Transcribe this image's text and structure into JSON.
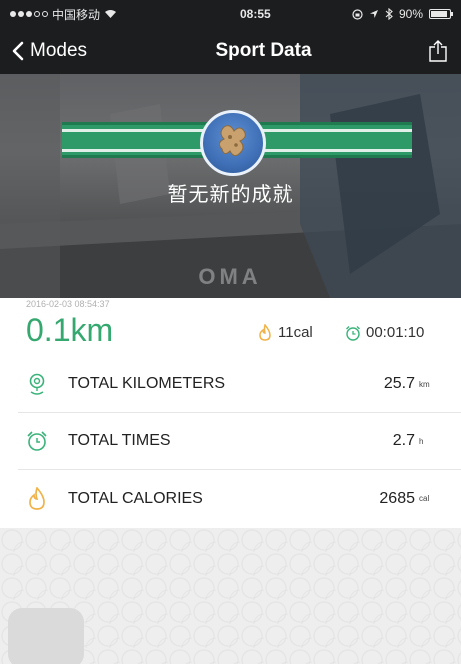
{
  "status_bar": {
    "carrier": "中国移动",
    "time": "08:55",
    "battery": "90%",
    "battery_level": 0.9
  },
  "nav": {
    "back_label": "Modes",
    "title": "Sport Data"
  },
  "hero": {
    "achievement_text": "暂无新的成就",
    "watermark": "OMA"
  },
  "summary": {
    "date": "2016-02-03 08:54:37",
    "distance": "0.1km",
    "calories": "11cal",
    "duration": "00:01:10"
  },
  "stats": [
    {
      "icon": "location-pin-icon",
      "label": "TOTAL KILOMETERS",
      "value": "25.7",
      "unit": "km"
    },
    {
      "icon": "alarm-clock-icon",
      "label": "TOTAL TIMES",
      "value": "2.7",
      "unit": "h"
    },
    {
      "icon": "flame-icon",
      "label": "TOTAL CALORIES",
      "value": "2685",
      "unit": "cal"
    }
  ],
  "colors": {
    "accent_green": "#35a86f",
    "icon_orange": "#f0b34a",
    "icon_green": "#3ab37a",
    "nav_bg": "#1c1d1f"
  }
}
